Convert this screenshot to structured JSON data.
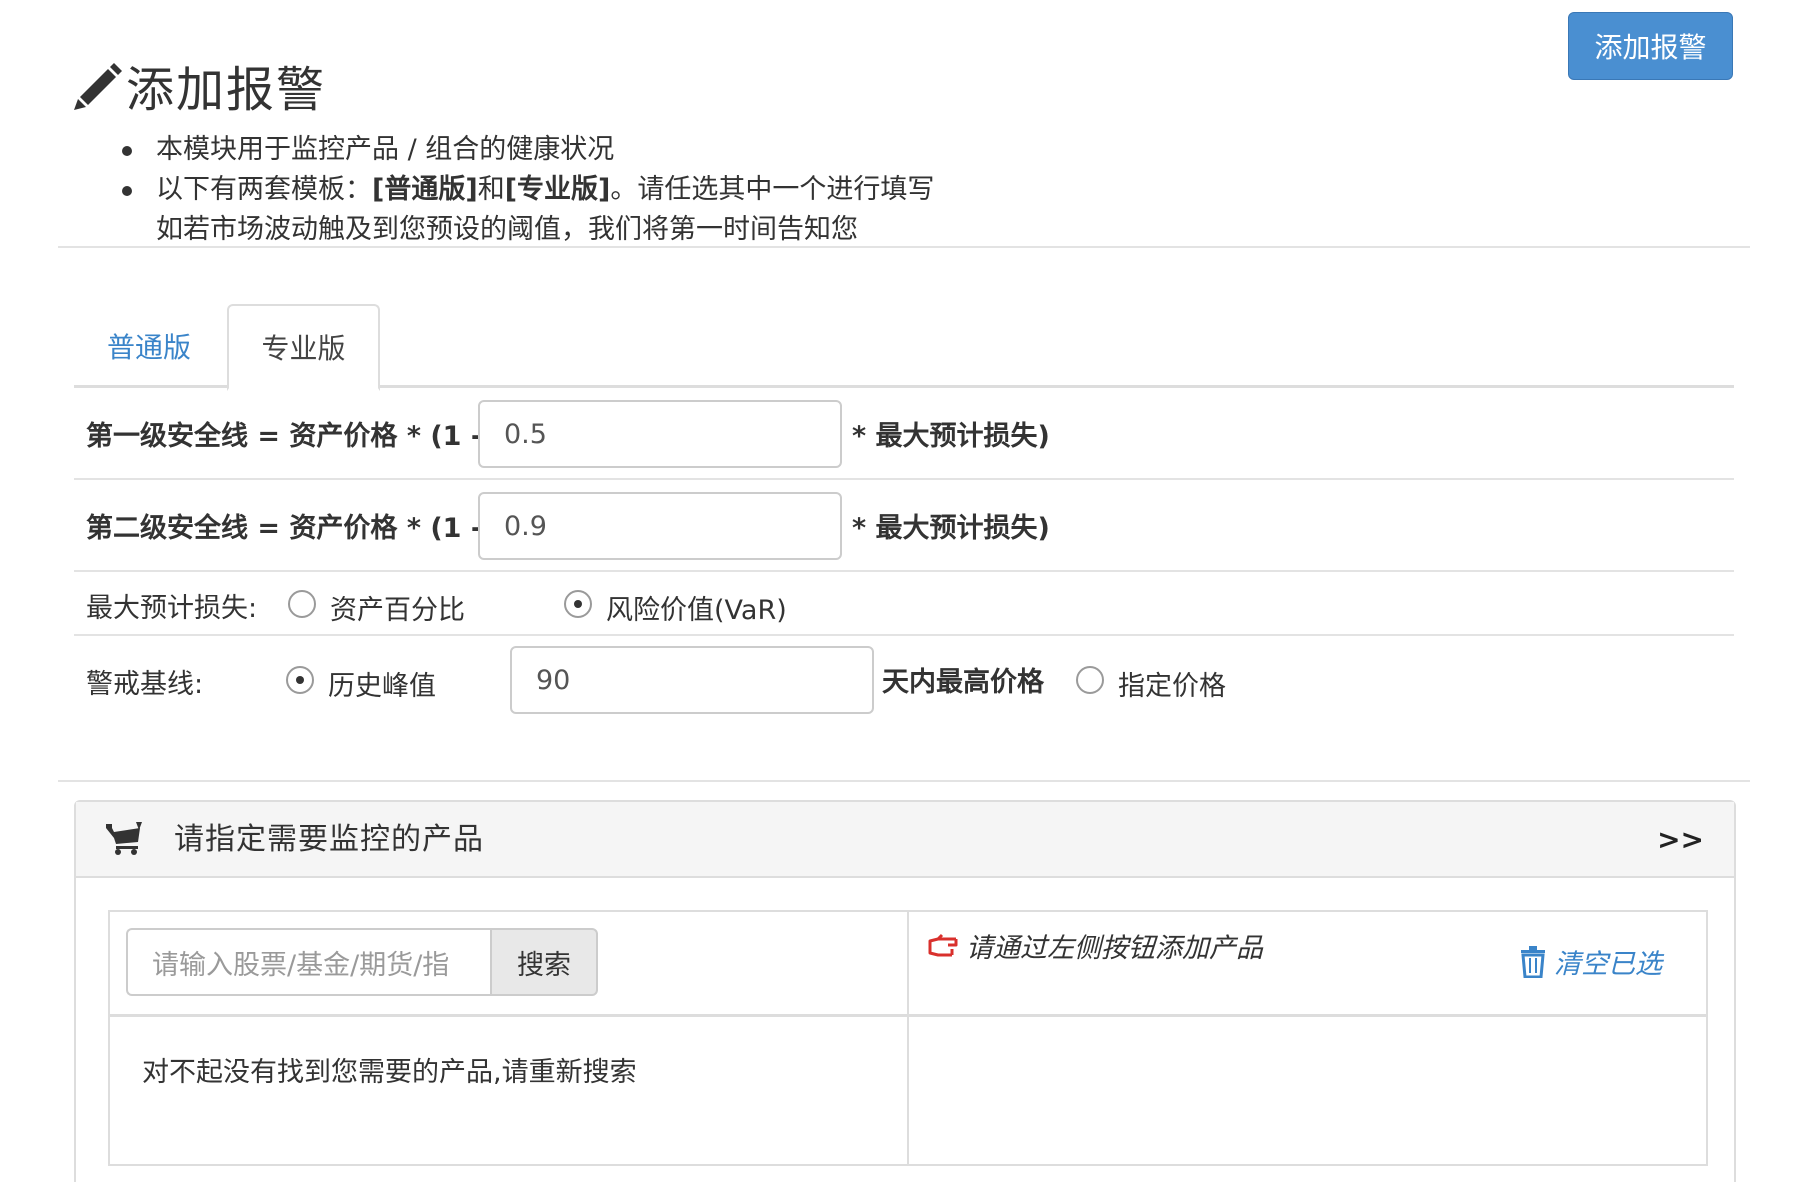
{
  "header": {
    "title": "添加报警",
    "add_button": "添加报警",
    "pencil_icon": "pencil-icon"
  },
  "intro": {
    "line1": "本模块用于监控产品 / 组合的健康状况",
    "line2_prefix": "以下有两套模板：",
    "line2_normal": "[普通版]",
    "line2_and": "和",
    "line2_pro": "[专业版]",
    "line2_suffix": "。请任选其中一个进行填写",
    "line3": "如若市场波动触及到您预设的阈值，我们将第一时间告知您"
  },
  "tabs": [
    {
      "label": "普通版",
      "active": false
    },
    {
      "label": "专业版",
      "active": true
    }
  ],
  "form": {
    "level1": {
      "prefix": "第一级安全线 = 资产价格 * (1 -",
      "value": "0.5",
      "suffix": "* 最大预计损失)"
    },
    "level2": {
      "prefix": "第二级安全线 = 资产价格 * (1 -",
      "value": "0.9",
      "suffix": "* 最大预计损失)"
    },
    "max_loss": {
      "label": "最大预计损失:",
      "option1": "资产百分比",
      "option2": "风险价值(VaR)",
      "selected": "option2"
    },
    "baseline": {
      "label": "警戒基线:",
      "option1": "历史峰值",
      "days_value": "90",
      "days_suffix": "天内最高价格",
      "option2": "指定价格",
      "selected": "option1"
    }
  },
  "products_panel": {
    "title": "请指定需要监控的产品",
    "expand": ">>",
    "search_placeholder": "请输入股票/基金/期货/指",
    "search_button": "搜索",
    "hint": "请通过左侧按钮添加产品",
    "clear_button": "清空已选",
    "no_result": "对不起没有找到您需要的产品,请重新搜索"
  },
  "colors": {
    "primary": "#4a8fd1",
    "link": "#3a84c9",
    "hint_icon": "#d9302c",
    "border": "#dddddd",
    "panel_header_bg": "#f5f5f5"
  }
}
